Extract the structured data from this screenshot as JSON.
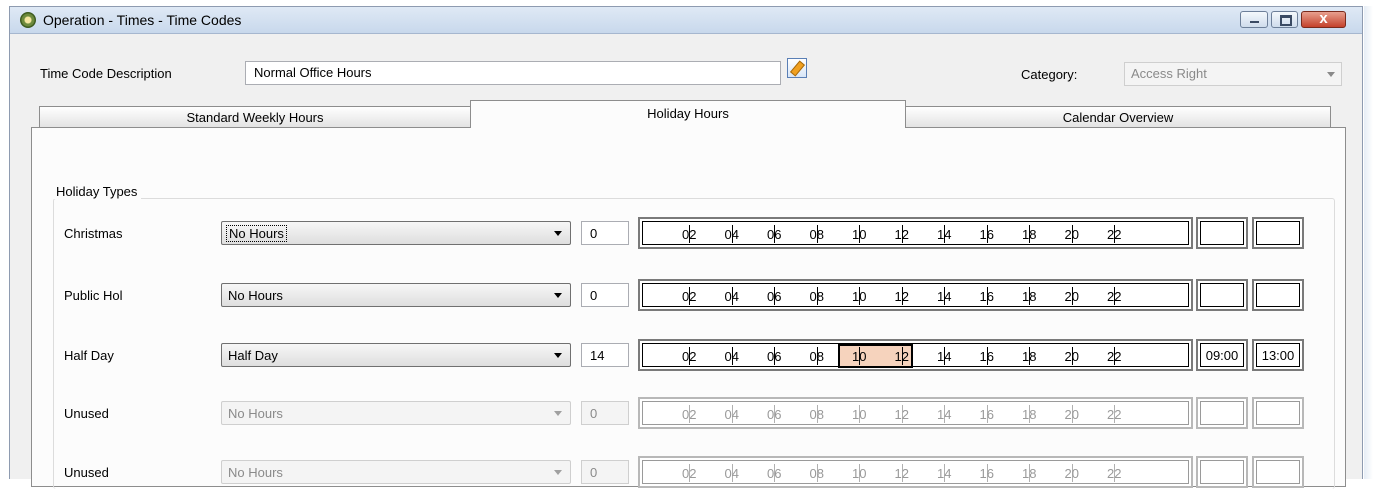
{
  "window": {
    "title": "Operation - Times - Time Codes",
    "close_glyph": "x"
  },
  "header": {
    "description_label": "Time Code Description",
    "description_value": "Normal Office Hours",
    "category_label": "Category:",
    "category_value": "Access Right"
  },
  "tabs": [
    {
      "label": "Standard Weekly Hours",
      "active": false
    },
    {
      "label": "Holiday Hours",
      "active": true
    },
    {
      "label": "Calendar Overview",
      "active": false
    }
  ],
  "holiday_types": {
    "title": "Holiday Types",
    "tick_labels": [
      "02",
      "04",
      "06",
      "08",
      "10",
      "12",
      "14",
      "16",
      "18",
      "20",
      "22"
    ],
    "rows": [
      {
        "label": "Christmas",
        "selection": "No Hours",
        "hours": "0",
        "start": "",
        "end": "",
        "enabled": true,
        "focused": true
      },
      {
        "label": "Public Hol",
        "selection": "No Hours",
        "hours": "0",
        "start": "",
        "end": "",
        "enabled": true,
        "focused": false
      },
      {
        "label": "Half Day",
        "selection": "Half Day",
        "hours": "14",
        "start": "09:00",
        "end": "13:00",
        "enabled": true,
        "focused": false,
        "highlight": [
          9,
          13
        ]
      },
      {
        "label": "Unused",
        "selection": "No Hours",
        "hours": "0",
        "start": "",
        "end": "",
        "enabled": false,
        "focused": false
      },
      {
        "label": "Unused",
        "selection": "No Hours",
        "hours": "0",
        "start": "",
        "end": "",
        "enabled": false,
        "focused": false
      }
    ]
  },
  "colors": {
    "highlight_fill": "#f6d3bd",
    "close_button": "#c4412b"
  }
}
